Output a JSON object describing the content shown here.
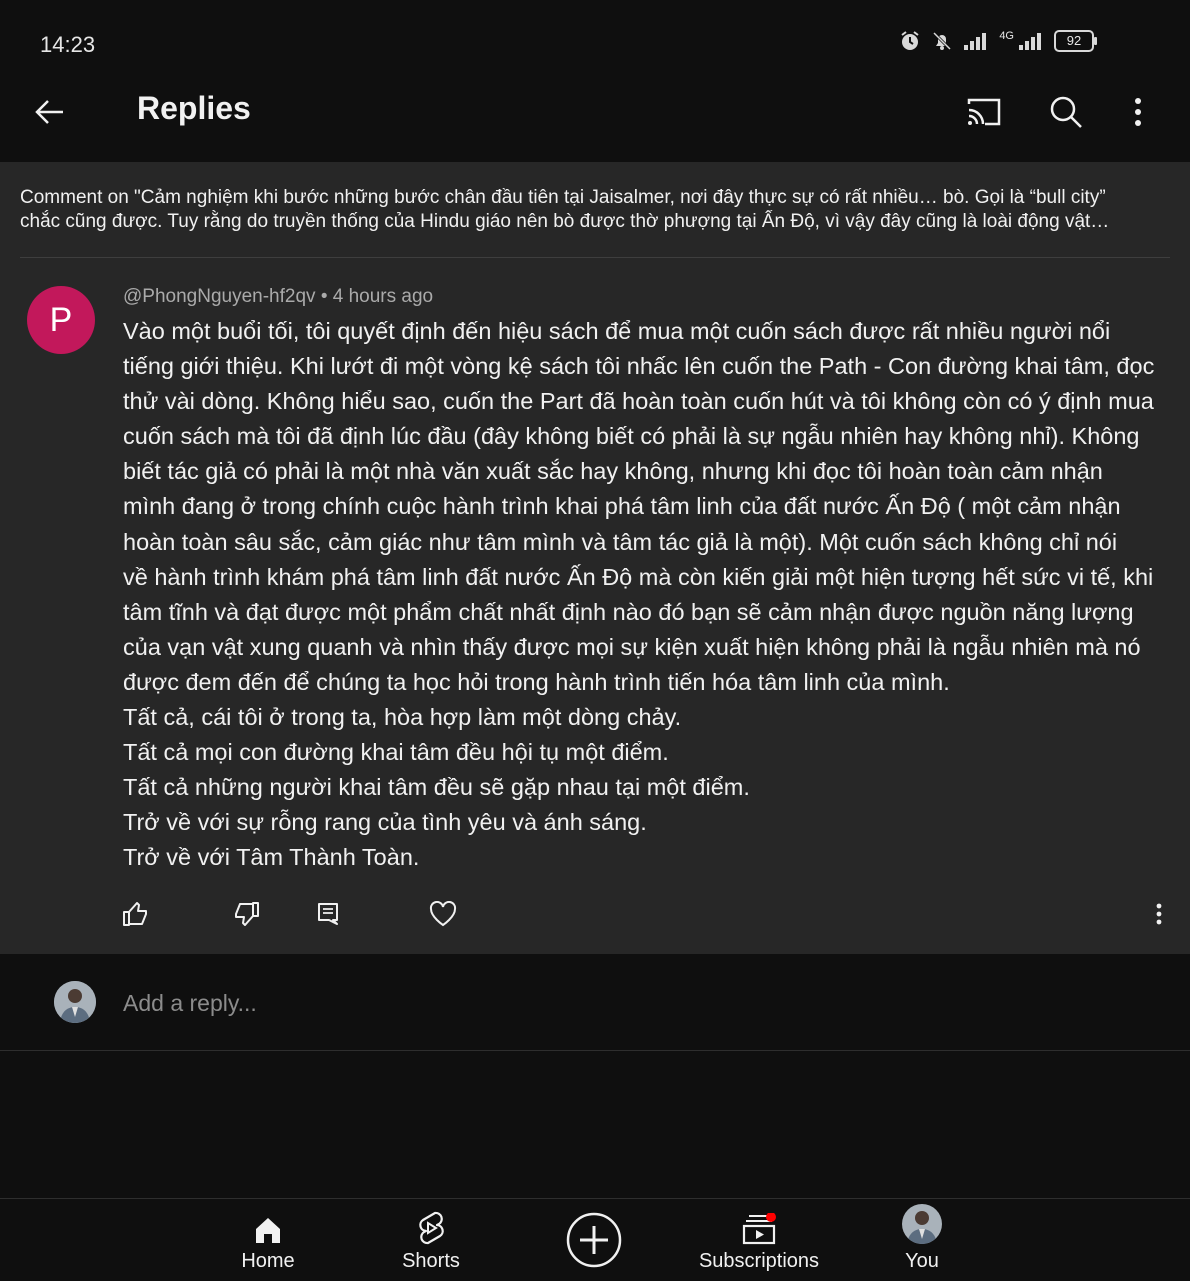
{
  "status": {
    "time": "14:23",
    "network": "4G",
    "battery": "92"
  },
  "header": {
    "title": "Replies"
  },
  "context": {
    "line1": "Comment on \"Cảm nghiệm khi bước những bước chân đầu tiên tại Jaisalmer, nơi đây thực sự có rất nhiều… bò. Gọi là “bull city”",
    "line2": "chắc cũng được. Tuy rằng do truyền thống của Hindu giáo nên bò được thờ phượng tại Ấn Độ, vì vậy đây cũng là loài động vật…"
  },
  "comment": {
    "avatar_letter": "P",
    "author": "@PhongNguyen-hf2qv",
    "separator": "•",
    "time": "4 hours ago",
    "lines": [
      "Vào một buổi tối, tôi quyết định đến hiệu sách để mua một cuốn sách được rất nhiều người nổi",
      "tiếng giới thiệu. Khi lướt đi một vòng kệ sách tôi nhấc lên cuốn the Path - Con đường khai tâm, đọc",
      "thử vài dòng. Không hiểu sao, cuốn the Part đã hoàn toàn cuốn hút và tôi không còn có ý định mua",
      "cuốn sách mà tôi đã định lúc đầu (đây không biết có phải là sự ngẫu nhiên hay không nhỉ). Không",
      "biết tác giả có phải là một nhà văn xuất sắc hay không, nhưng khi đọc tôi hoàn toàn cảm nhận",
      "mình đang ở trong chính cuộc hành trình khai phá tâm linh của đất nước Ấn Độ ( một cảm nhận",
      "hoàn toàn sâu sắc, cảm giác như tâm mình và tâm tác giả là một). Một cuốn sách không chỉ nói",
      "về hành trình khám phá tâm linh đất nước Ấn Độ mà còn kiến giải một hiện tượng hết sức vi tế, khi",
      "tâm tĩnh và đạt được một phẩm chất nhất định nào đó bạn sẽ cảm nhận được nguồn năng lượng",
      "của vạn vật xung quanh và nhìn thấy được mọi sự kiện xuất hiện không phải là ngẫu nhiên mà nó",
      "được đem đến để chúng ta học hỏi trong hành trình tiến hóa tâm linh của mình.",
      "Tất cả, cái tôi ở trong ta, hòa hợp làm một dòng chảy.",
      "Tất cả mọi con đường khai tâm đều hội tụ một điểm.",
      "Tất cả những người khai tâm đều sẽ gặp nhau tại một điểm.",
      "Trở về với sự rỗng rang của tình yêu và ánh sáng.",
      "Trở về với Tâm Thành Toàn."
    ]
  },
  "reply": {
    "placeholder": "Add a reply..."
  },
  "nav": {
    "home": "Home",
    "shorts": "Shorts",
    "subscriptions": "Subscriptions",
    "you": "You"
  },
  "colors": {
    "avatar": "#c2185b",
    "panel": "#272727",
    "background": "#0f0f0f",
    "badge": "#ff0000"
  }
}
